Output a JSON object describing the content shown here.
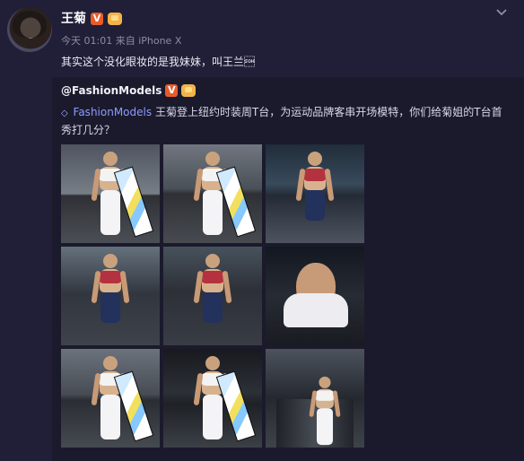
{
  "post": {
    "author": "王菊",
    "meta": "今天 01:01 来自 iPhone X",
    "content": "其实这个没化眼妆的是我妹妹，叫王兰\u0001"
  },
  "repost": {
    "author": "@FashionModels",
    "mention": "FashionModels",
    "text": " 王菊登上纽约时装周T台，为运动品牌客串开场模特，你们给菊姐的T台首秀打几分？"
  },
  "icons": {
    "avatar": "avatar",
    "vip": "verified-badge",
    "crown": "member-crown-icon",
    "more": "chevron-down-icon",
    "diamond": "diamond-icon"
  },
  "images": [
    "runway-photo-1",
    "runway-photo-2",
    "runway-photo-3",
    "runway-photo-4",
    "runway-photo-5",
    "runway-photo-6",
    "runway-photo-7",
    "runway-photo-8",
    "runway-photo-9"
  ]
}
